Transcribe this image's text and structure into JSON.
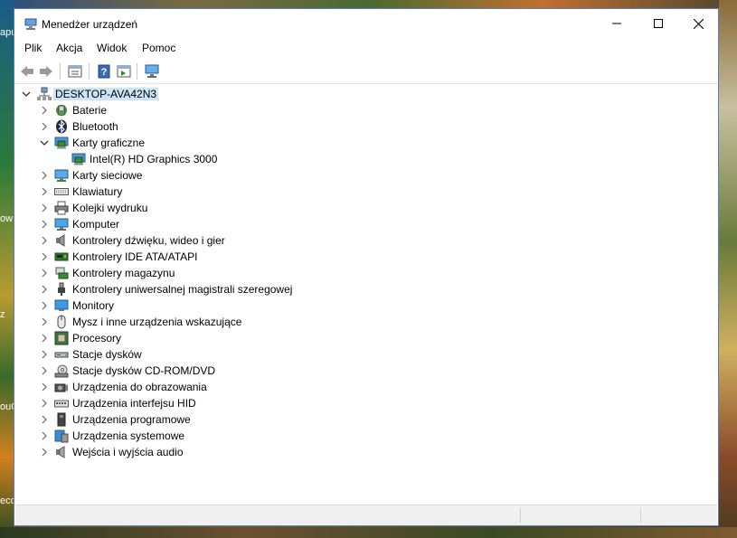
{
  "desktop": {
    "labels": [
      "apu",
      "ow",
      "z",
      "ouC",
      "ecc"
    ]
  },
  "window": {
    "title": "Menedżer urządzeń"
  },
  "menu": [
    "Plik",
    "Akcja",
    "Widok",
    "Pomoc"
  ],
  "toolbar": {
    "buttons": [
      "back-arrow-icon",
      "forward-arrow-icon",
      "properties-icon",
      "help-icon",
      "run-icon",
      "monitor-scan-icon"
    ]
  },
  "tree": {
    "root": "DESKTOP-AVA42N3",
    "items": [
      {
        "label": "Baterie",
        "icon": "battery-icon",
        "expanded": false
      },
      {
        "label": "Bluetooth",
        "icon": "bluetooth-icon",
        "expanded": false
      },
      {
        "label": "Karty graficzne",
        "icon": "display-adapter-icon",
        "expanded": true,
        "children": [
          "Intel(R) HD Graphics 3000"
        ]
      },
      {
        "label": "Karty sieciowe",
        "icon": "network-icon",
        "expanded": false
      },
      {
        "label": "Klawiatury",
        "icon": "keyboard-icon",
        "expanded": false
      },
      {
        "label": "Kolejki wydruku",
        "icon": "printer-icon",
        "expanded": false
      },
      {
        "label": "Komputer",
        "icon": "computer-icon",
        "expanded": false
      },
      {
        "label": "Kontrolery dźwięku, wideo i gier",
        "icon": "speaker-icon",
        "expanded": false
      },
      {
        "label": "Kontrolery IDE ATA/ATAPI",
        "icon": "ide-controller-icon",
        "expanded": false
      },
      {
        "label": "Kontrolery magazynu",
        "icon": "storage-controller-icon",
        "expanded": false
      },
      {
        "label": "Kontrolery uniwersalnej magistrali szeregowej",
        "icon": "usb-icon",
        "expanded": false
      },
      {
        "label": "Monitory",
        "icon": "monitor-icon",
        "expanded": false
      },
      {
        "label": "Mysz i inne urządzenia wskazujące",
        "icon": "mouse-icon",
        "expanded": false
      },
      {
        "label": "Procesory",
        "icon": "processor-icon",
        "expanded": false
      },
      {
        "label": "Stacje dysków",
        "icon": "disk-drive-icon",
        "expanded": false
      },
      {
        "label": "Stacje dysków CD-ROM/DVD",
        "icon": "cd-drive-icon",
        "expanded": false
      },
      {
        "label": "Urządzenia do obrazowania",
        "icon": "camera-icon",
        "expanded": false
      },
      {
        "label": "Urządzenia interfejsu HID",
        "icon": "hid-icon",
        "expanded": false
      },
      {
        "label": "Urządzenia programowe",
        "icon": "software-device-icon",
        "expanded": false
      },
      {
        "label": "Urządzenia systemowe",
        "icon": "system-device-icon",
        "expanded": false
      },
      {
        "label": "Wejścia i wyjścia audio",
        "icon": "audio-io-icon",
        "expanded": false
      }
    ]
  },
  "colors": {
    "selection": "#cce4f7",
    "chevron": "#606060",
    "accent": "#1e6fc0"
  }
}
